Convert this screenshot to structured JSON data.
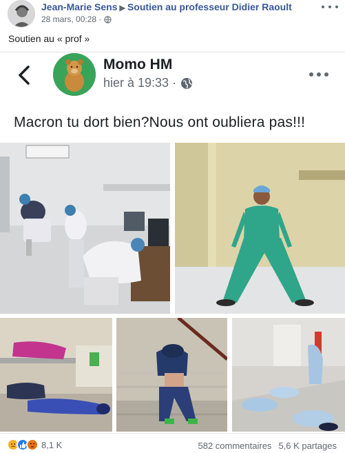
{
  "post": {
    "author": "Jean-Marie Sens",
    "group": "Soutien au professeur Didier Raoult",
    "timestamp": "28 mars, 00:28 ·",
    "text": "Soutien au « prof »"
  },
  "shared": {
    "name": "Momo HM",
    "time": "hier à 19:33 ·",
    "caption": "Macron tu dort bien?Nous ont oubliera pas!!!"
  },
  "footer": {
    "reaction_count": "8,1 K",
    "comments": "582 commentaires",
    "shares": "5,6 K partages"
  },
  "colors": {
    "link": "#385898",
    "secondary_text": "#606770",
    "avatar_green": "#3aa35a",
    "scrubs_teal": "#2fa58a"
  }
}
